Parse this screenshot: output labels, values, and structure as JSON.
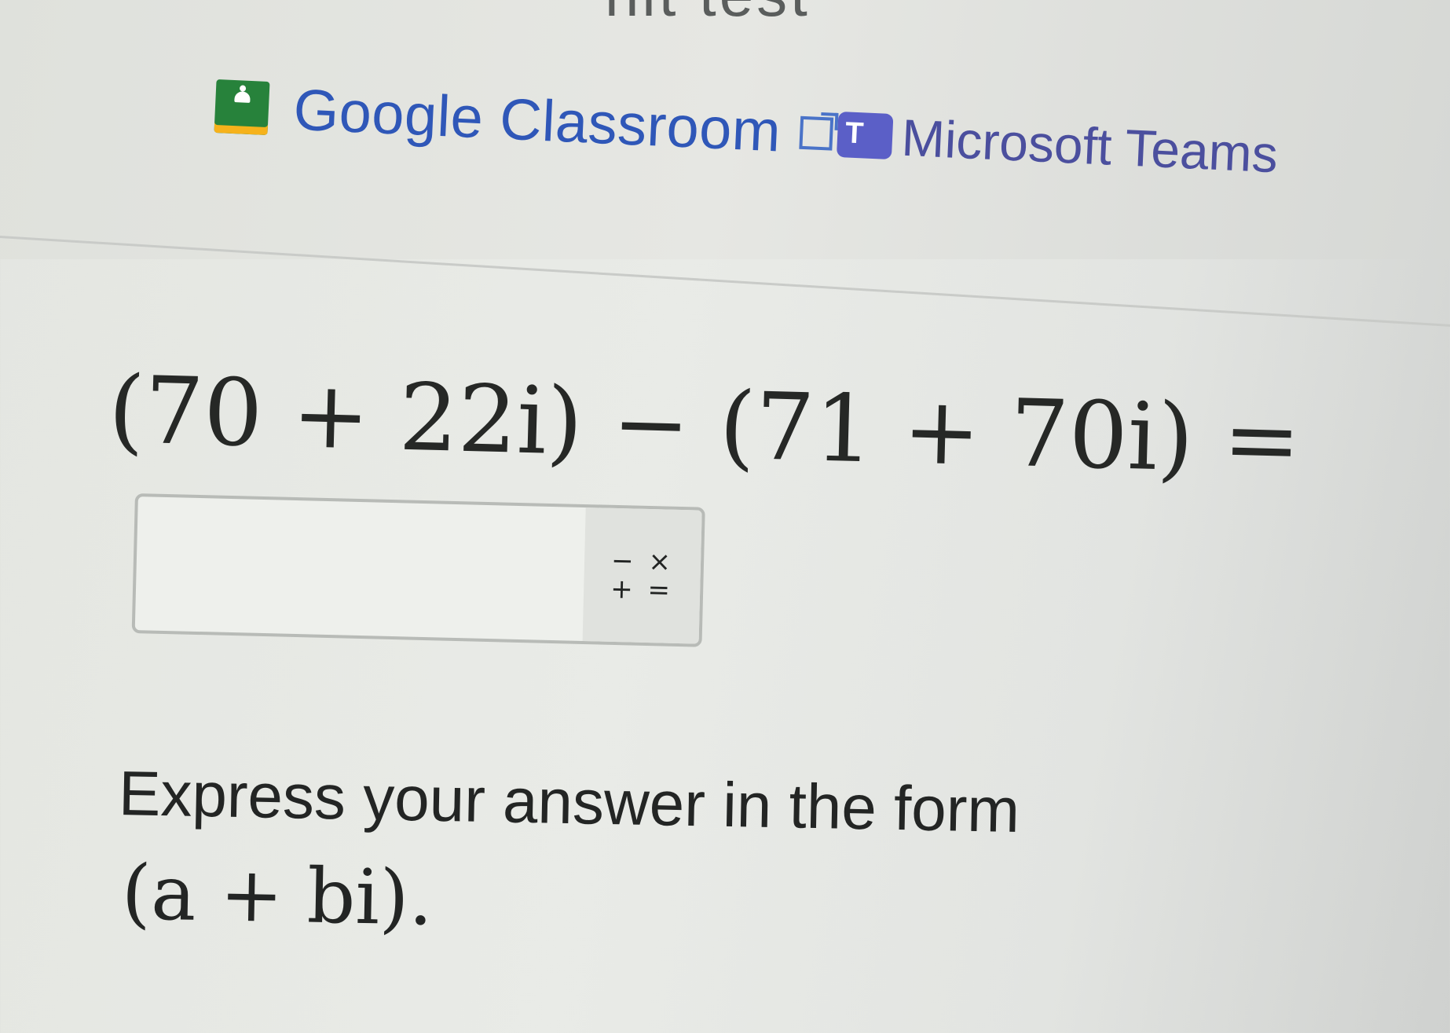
{
  "header": {
    "title_fragment": "nit test"
  },
  "share": {
    "google_classroom_label": "Google Classroom",
    "microsoft_teams_label": "Microsoft Teams"
  },
  "problem": {
    "expression": "(70 + 22i) − (71 + 70i) ="
  },
  "answer": {
    "value": "",
    "ops_top": "− ×",
    "ops_bottom": "+ ="
  },
  "instructions": {
    "text": "Express your answer in the form",
    "form": "(a + bi)."
  }
}
